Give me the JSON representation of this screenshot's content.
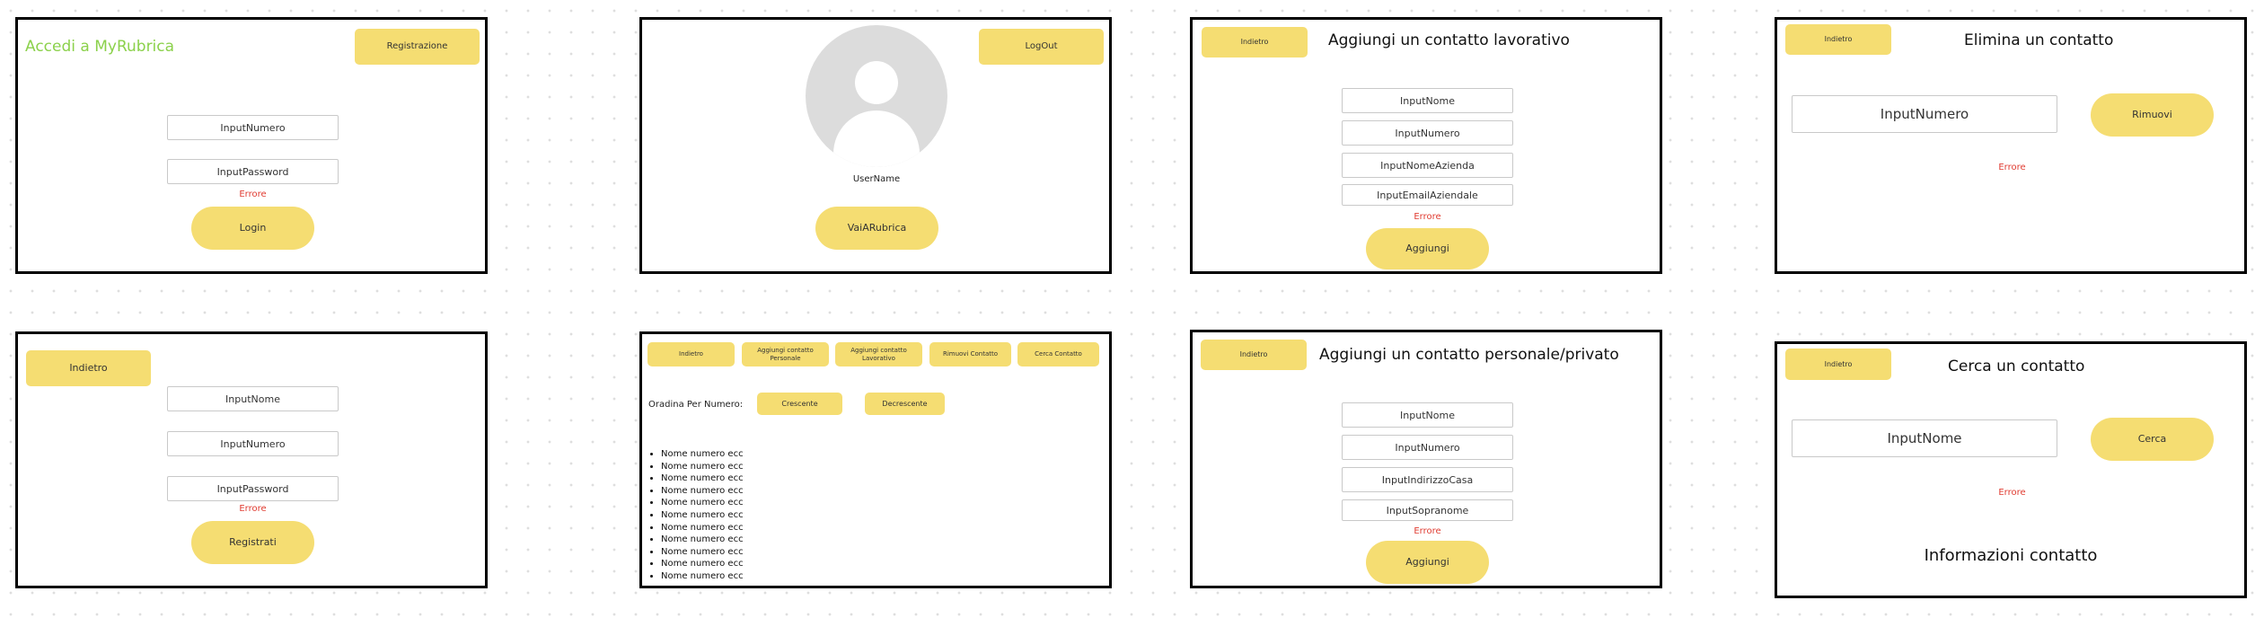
{
  "login": {
    "title": "Accedi a MyRubrica",
    "register_button": "Registrazione",
    "input_number": "InputNumero",
    "input_password": "InputPassword",
    "error": "Errore",
    "login_button": "Login"
  },
  "profile": {
    "logout_button": "LogOut",
    "username": "UserName",
    "go_button": "VaiARubrica"
  },
  "add_work": {
    "back_button": "Indietro",
    "title": "Aggiungi un contatto lavorativo",
    "input_name": "InputNome",
    "input_number": "InputNumero",
    "input_company": "InputNomeAzienda",
    "input_email": "InputEmailAziendale",
    "error": "Errore",
    "add_button": "Aggiungi"
  },
  "delete": {
    "back_button": "Indietro",
    "title": "Elimina un contatto",
    "input_number": "InputNumero",
    "remove_button": "Rimuovi",
    "error": "Errore"
  },
  "register": {
    "back_button": "Indietro",
    "input_name": "InputNome",
    "input_number": "InputNumero",
    "input_password": "InputPassword",
    "error": "Errore",
    "register_button": "Registrati"
  },
  "rubrica": {
    "nav": [
      "Indietro",
      "Aggiungi contatto Personale",
      "Aggiungi contatto Lavorativo",
      "Rimuovi Contatto",
      "Cerca Contatto"
    ],
    "sort_label": "Oradina Per Numero:",
    "sort_asc": "Crescente",
    "sort_desc": "Decrescente",
    "items": [
      "Nome numero ecc",
      "Nome numero ecc",
      "Nome numero ecc",
      "Nome numero ecc",
      "Nome numero ecc",
      "Nome numero ecc",
      "Nome numero ecc",
      "Nome numero ecc",
      "Nome numero ecc",
      "Nome numero ecc",
      "Nome numero ecc"
    ]
  },
  "add_personal": {
    "back_button": "Indietro",
    "title": "Aggiungi un contatto personale/privato",
    "input_name": "InputNome",
    "input_number": "InputNumero",
    "input_address": "InputIndirizzoCasa",
    "input_nickname": "InputSopranome",
    "error": "Errore",
    "add_button": "Aggiungi"
  },
  "search": {
    "back_button": "Indietro",
    "title": "Cerca un contatto",
    "input_name": "InputNome",
    "search_button": "Cerca",
    "error": "Errore",
    "info_title": "Informazioni contatto"
  },
  "colors": {
    "button": "#f5dd72",
    "error": "#e03c31",
    "login_title": "#8bd14b",
    "border": "#000000"
  }
}
